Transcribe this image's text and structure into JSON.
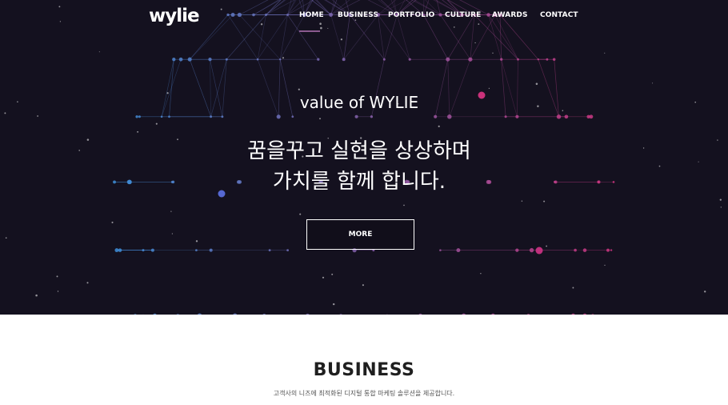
{
  "brand": {
    "logo_text": "wylie"
  },
  "nav": {
    "items": [
      {
        "label": "HOME",
        "active": true
      },
      {
        "label": "BUSINESS",
        "active": false
      },
      {
        "label": "PORTFOLIO",
        "active": false
      },
      {
        "label": "CULTURE",
        "active": false
      },
      {
        "label": "AWARDS",
        "active": false
      },
      {
        "label": "CONTACT",
        "active": false
      }
    ]
  },
  "hero": {
    "subtitle": "value of WYLIE",
    "title_line1": "꿈을꾸고 실현을 상상하며",
    "title_line2": "가치를 함께 합니다.",
    "more_label": "MORE"
  },
  "business": {
    "title": "BUSINESS",
    "description": "고객사의 니즈에 최적화된 디지털 통합 마케팅 솔루션을 제공합니다."
  },
  "colors": {
    "hero_bg": "#14111f",
    "network_blue": "#3d8fd9",
    "network_pink": "#d4347f",
    "nav_active": "#8a5a8f"
  }
}
